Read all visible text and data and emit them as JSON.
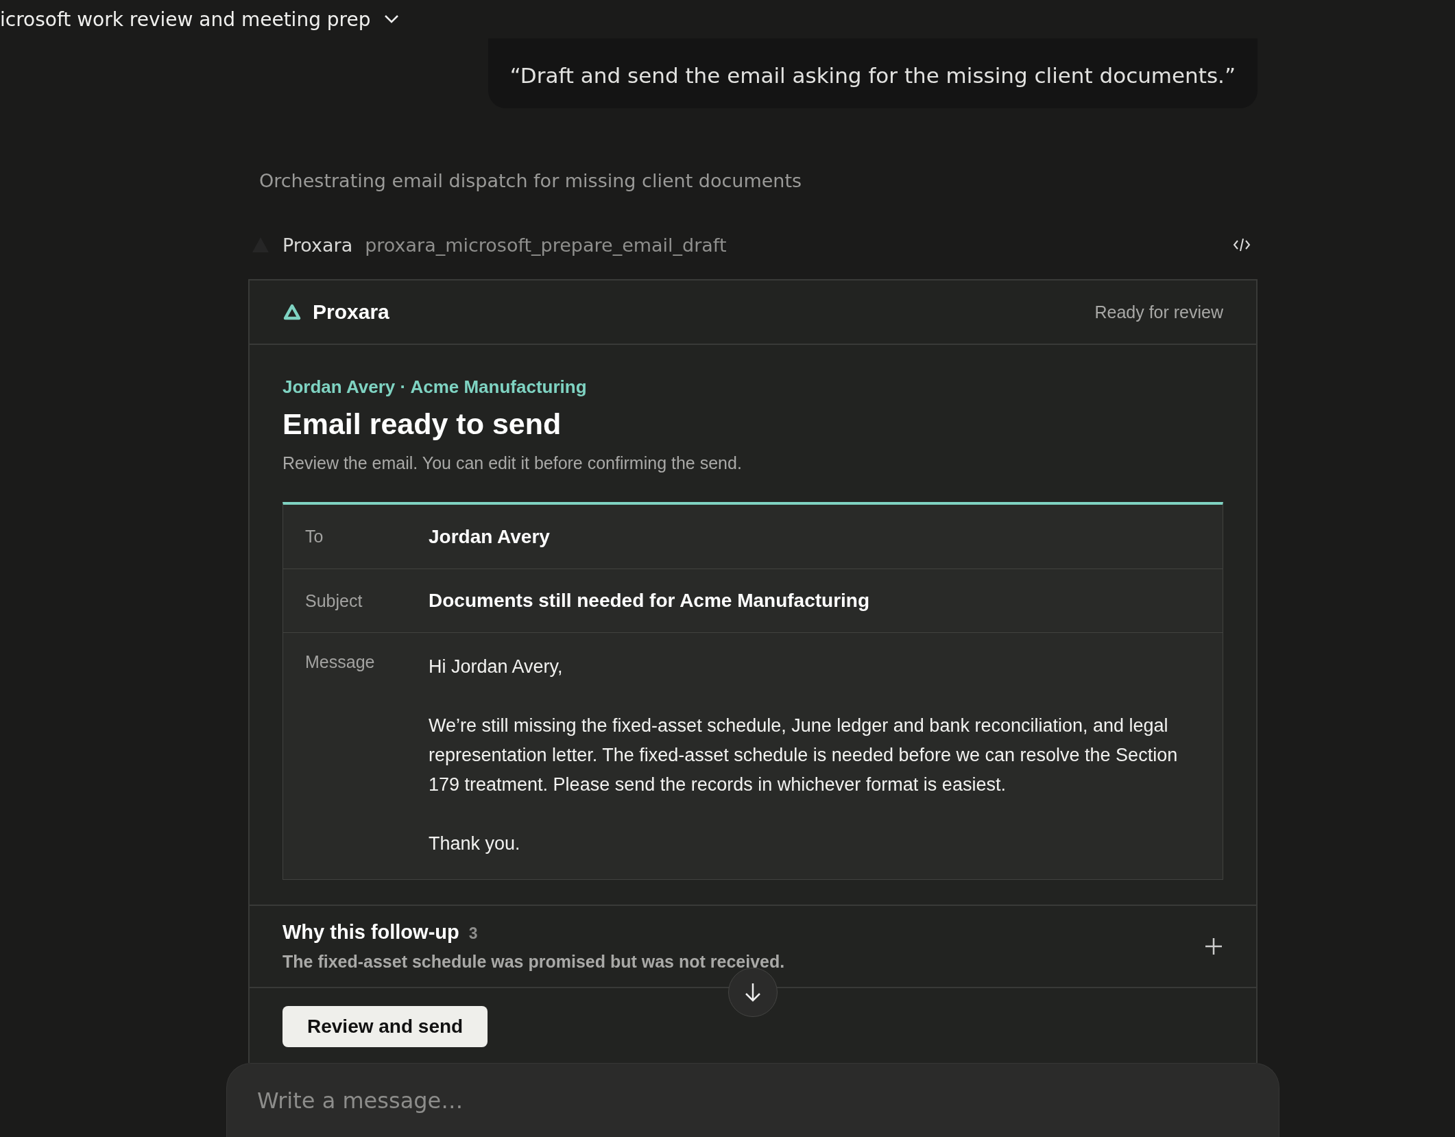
{
  "header": {
    "title": "icrosoft work review and meeting prep"
  },
  "user_message": "“Draft and send the email asking for the missing client documents.”",
  "status": "Orchestrating email dispatch for missing client documents",
  "tool_call": {
    "app": "Proxara",
    "function": "proxara_microsoft_prepare_email_draft"
  },
  "card": {
    "brand": "Proxara",
    "status": "Ready for review",
    "eyebrow": "Jordan Avery · Acme Manufacturing",
    "title": "Email ready to send",
    "subtitle": "Review the email. You can edit it before confirming the send.",
    "fields": [
      {
        "kind": "line",
        "label": "To",
        "value": "Jordan Avery"
      },
      {
        "kind": "line",
        "label": "Subject",
        "value": "Documents still needed for Acme Manufacturing"
      },
      {
        "kind": "message",
        "label": "Message",
        "paragraphs": [
          "Hi Jordan Avery,",
          "We’re still missing the fixed-asset schedule, June ledger and bank reconciliation, and legal representation letter. The fixed-asset schedule is needed before we can resolve the Section 179 treatment. Please send the records in whichever format is easiest.",
          "Thank you."
        ]
      }
    ],
    "why": {
      "title": "Why this follow-up",
      "count": "3",
      "summary": "The fixed-asset schedule was promised but was not received.",
      "expanded": false
    },
    "primary_button": "Review and send"
  },
  "composer": {
    "placeholder": "Write a message…"
  }
}
